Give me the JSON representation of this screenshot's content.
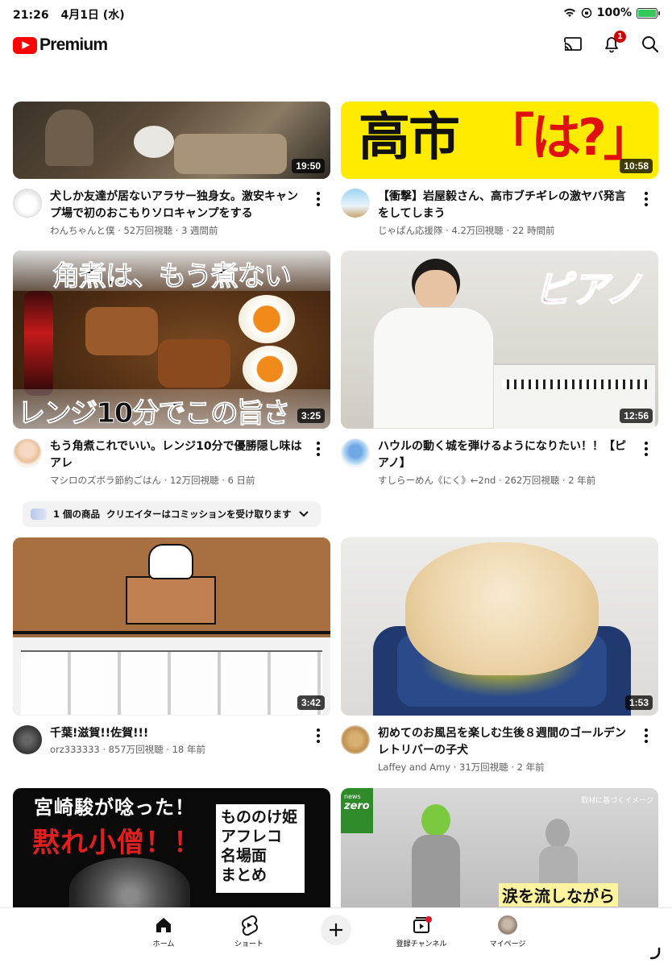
{
  "status": {
    "time": "21:26",
    "date": "4月1日 (水)",
    "battery": "100%"
  },
  "header": {
    "brand": "Premium",
    "notification_count": "1"
  },
  "videos": [
    {
      "title": "犬しか友達が居ないアラサー独身女。激安キャンプ場で初のおこもりソロキャンプをする",
      "meta": "わんちゃんと僕 · 52万回視聴 · 3 週間前",
      "duration": "19:50"
    },
    {
      "title": "【衝撃】岩屋毅さん、高市ブチギレの激ヤバ発言をしてしまう",
      "meta": "じゃぱん応援隊 · 4.2万回視聴 · 22 時間前",
      "duration": "10:58",
      "thumb_text": [
        "高市",
        "「は?」"
      ]
    },
    {
      "title": "もう角煮これでいい。レンジ10分で優勝隠し味はアレ",
      "meta": "マシロのズボラ節約ごはん · 12万回視聴 · 6 日前",
      "duration": "3:25",
      "thumb_text": [
        "角煮は、もう煮ない",
        "レンジ10分でこの旨さ"
      ]
    },
    {
      "title": "ハウルの動く城を弾けるようになりたい！！【ピアノ】",
      "meta": "すしらーめん《にく》←2nd · 262万回視聴 · 2 年前",
      "duration": "12:56",
      "thumb_text": [
        "ピアノ"
      ]
    },
    {
      "title": "千葉!滋賀!!佐賀!!!",
      "meta": "orz333333 · 857万回視聴 · 18 年前",
      "duration": "3:42"
    },
    {
      "title": "初めてのお風呂を楽しむ生後８週間のゴールデンレトリバーの子犬",
      "meta": "Laffey and Amy · 31万回視聴 · 2 年前",
      "duration": "1:53"
    },
    {
      "thumb_text": [
        "宮崎駿が唸った！",
        "黙れ小僧！！",
        "もののけ姫",
        "アフレコ",
        "名場面",
        "まとめ"
      ]
    },
    {
      "thumb_text": [
        "news",
        "zero",
        "取材に基づくイメージ",
        "涙を流しながら"
      ]
    }
  ],
  "products": {
    "label": "1 個の商品",
    "note": "クリエイターはコミッションを受け取ります"
  },
  "tabs": [
    {
      "label": "ホーム"
    },
    {
      "label": "ショート"
    },
    {
      "label": "登録チャンネル"
    },
    {
      "label": "マイページ"
    }
  ],
  "colors": {
    "brand": "#ff0000",
    "badge": "#cc0000"
  }
}
